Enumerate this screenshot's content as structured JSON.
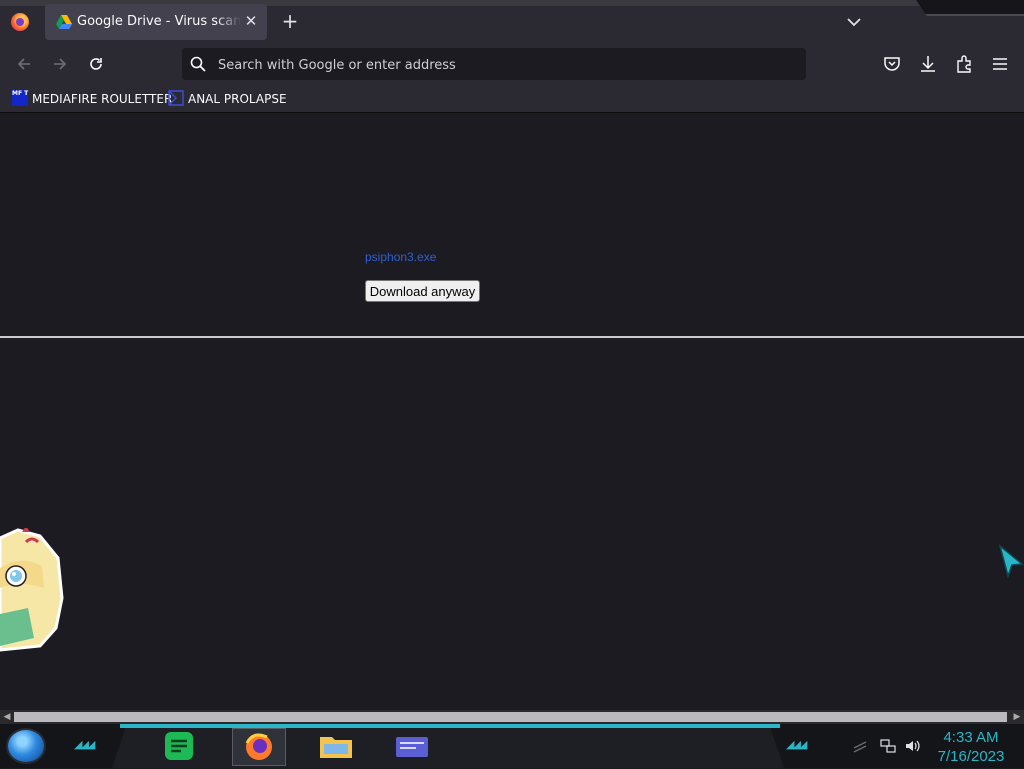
{
  "browser": {
    "tab": {
      "title": "Google Drive - Virus scan warning",
      "close_label": "✕"
    },
    "new_tab_label": "+",
    "url_placeholder": "Search with Google or enter address"
  },
  "bookmarks": [
    {
      "label": "MEDIAFIRE ROULETTER",
      "icon": "MF T"
    },
    {
      "label": "ANAL PROLAPSE"
    }
  ],
  "page": {
    "file_name": "psiphon3.exe",
    "download_button": "Download anyway"
  },
  "taskbar": {
    "apps": [
      "spotify-icon",
      "firefox-icon",
      "file-explorer-icon",
      "media-icon"
    ],
    "time": "4:33 AM",
    "date": "7/16/2023"
  },
  "colors": {
    "accent": "#2ab6c7",
    "link": "#2f5fd0",
    "chrome": "#2b2a33",
    "page_bg": "#1c1b22"
  }
}
